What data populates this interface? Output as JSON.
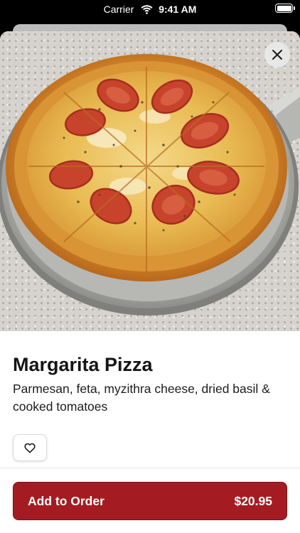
{
  "status_bar": {
    "carrier": "Carrier",
    "time": "9:41 AM"
  },
  "item": {
    "name": "Margarita Pizza",
    "description": "Parmesan, feta, myzithra cheese, dried basil & cooked tomatoes",
    "image_icon": "pizza-photo"
  },
  "actions": {
    "close_icon": "close-icon",
    "favorite_icon": "heart-icon",
    "add_label": "Add to Order",
    "price": "$20.95"
  },
  "colors": {
    "accent": "#a41c22",
    "text": "#151515",
    "background": "#ffffff"
  }
}
